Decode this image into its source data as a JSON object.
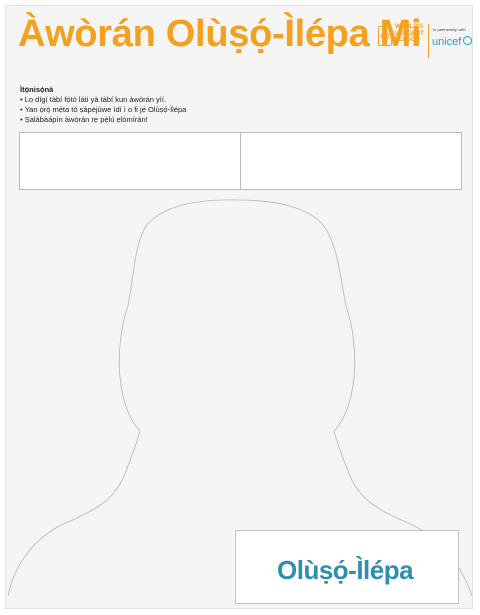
{
  "page": {
    "title": "Àwòrán Olùṣọ́-Ìlépa Mi"
  },
  "logos": {
    "wll_text": "WORLD'S\nLARGEST\nLESSON",
    "partner_text": "In partnership with",
    "unicef_text": "unicef"
  },
  "instructions": {
    "heading": "Ìtọ́nisọ́nà",
    "items": [
      "Lo dígí tàbí fọ́tò láti yà tàbí kun àwòrán yìí.",
      "Yan ọ̀rọ̀ mẹ́ta tó ṣàpèjúwe ìdí ì o fi jẹ́ Olùṣọ́-Ìlépa",
      "Ṣalábàápín àwòrán rẹ pẹ̀lú ẹlòmíràn!"
    ]
  },
  "label": {
    "text": "Olùṣọ́-Ìlépa"
  },
  "colors": {
    "title": "#f5a01e",
    "label": "#2f8eb0",
    "unicef": "#1ca0db"
  }
}
